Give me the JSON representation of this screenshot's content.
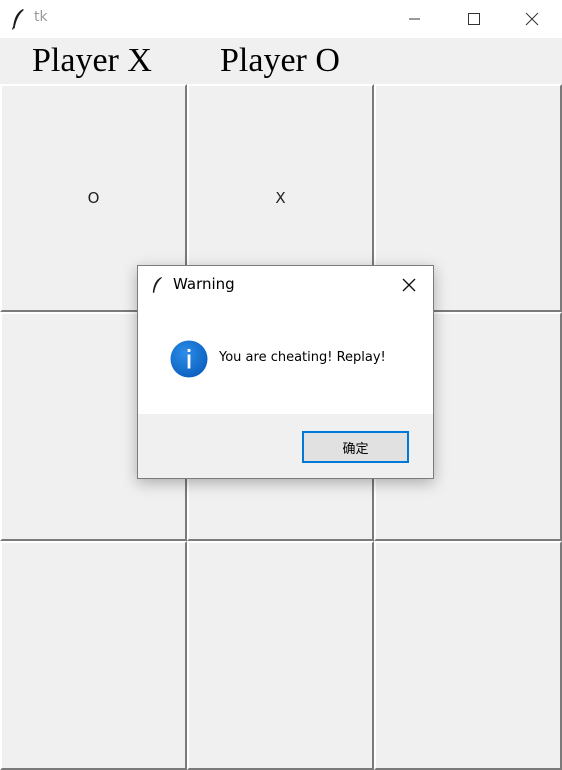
{
  "window": {
    "title": "tk",
    "icon": "tk-feather-icon",
    "controls": [
      "minimize-icon",
      "maximize-icon",
      "close-icon"
    ]
  },
  "header": {
    "player_x": "Player X",
    "player_o": "Player O"
  },
  "board": {
    "cells": [
      "O",
      "X",
      "",
      "",
      "",
      "",
      "",
      "",
      ""
    ]
  },
  "dialog": {
    "title": "Warning",
    "message": "You are cheating! Replay!",
    "ok_label": "确定",
    "icon": "info-icon",
    "accent_color": "#0078d7",
    "icon_color": "#0a67c8"
  }
}
